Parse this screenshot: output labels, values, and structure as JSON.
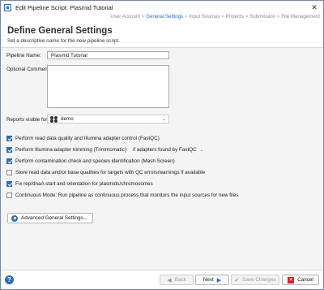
{
  "window": {
    "title": "Edit Pipeline Script: Plasmid Tutorial",
    "close_glyph": "✕"
  },
  "breadcrumbs": [
    "User Account",
    "General Settings",
    "Input Sources",
    "Projects",
    "Submission",
    "File Management"
  ],
  "breadcrumb_active": "General Settings",
  "breadcrumb_separator": ">",
  "header": {
    "title": "Define General Settings",
    "subtitle": "Set a descriptive name for the new pipeline script."
  },
  "form": {
    "pipeline_name_label": "Pipeline Name:",
    "pipeline_name_value": "Plasmid Tutorial",
    "optional_comment_label": "Optional Comment:",
    "optional_comment_value": "",
    "reports_visible_label": "Reports visible for:",
    "reports_visible_value": "demo",
    "checks": [
      {
        "label": "Perform read data quality and Illumina adapter control (FastQC)",
        "checked": true
      },
      {
        "label": "Perform Illumina adapter trimming (Trimmomatic)",
        "checked": true,
        "option": "if adapters found by FastQC"
      },
      {
        "label": "Perform contamination check and species identification (Mash Screen)",
        "checked": true
      },
      {
        "label": "Store read data and/or base qualities for targets with QC errors/warnings if available",
        "checked": false
      },
      {
        "label": "Fix rep/dnaA start and orientation for plasmids/chromosomes",
        "checked": true
      },
      {
        "label": "Continuous Mode: Run pipeline as continuous process that monitors the input sources for new files",
        "checked": false
      }
    ],
    "advanced_button": "Advanced General Settings..."
  },
  "footer": {
    "help_glyph": "?",
    "back": "Back",
    "next": "Next",
    "save": "Save Changes",
    "cancel": "Cancel"
  },
  "colors": {
    "accent": "#2f6db5",
    "cancel_red": "#c62828"
  }
}
